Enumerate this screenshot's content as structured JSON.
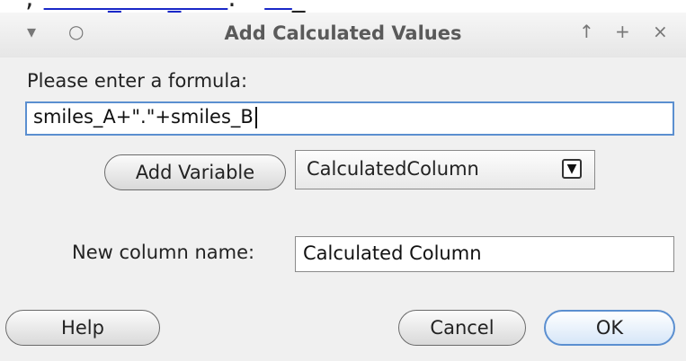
{
  "background_text": {
    "segment_1": "' ', ",
    "segment_2": "       _     _     ",
    "segment_3": ".   ",
    "segment_4": "   ",
    "segment_5": "_    '"
  },
  "window": {
    "title": "Add Calculated Values",
    "menu_icon": "▾",
    "circle_icon": "○",
    "up_icon": "↑",
    "plus_icon": "+",
    "close_icon": "×"
  },
  "form": {
    "formula_label": "Please enter a formula:",
    "formula_value": "smiles_A+\".\"+smiles_B",
    "add_variable_label": "Add Variable",
    "variable_select_value": "CalculatedColumn",
    "column_name_label": "New column name:",
    "column_name_value": "Calculated Column"
  },
  "buttons": {
    "help": "Help",
    "cancel": "Cancel",
    "ok": "OK"
  },
  "colors": {
    "accent": "#5b8fd0",
    "title_text": "#5a5a5a",
    "background": "#f0f0f0"
  }
}
